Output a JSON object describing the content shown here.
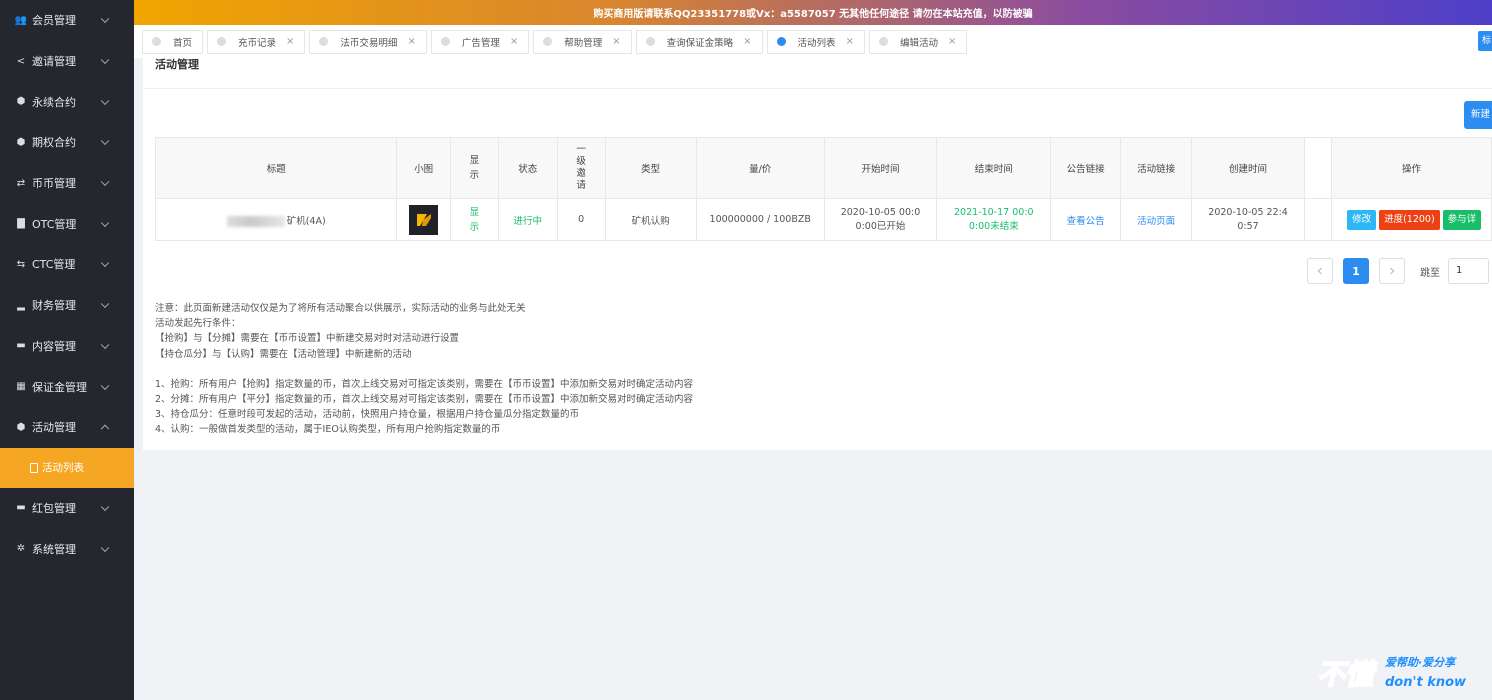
{
  "banner": {
    "text": "购买商用版请联系QQ23351778或Vx：a5587057 无其他任何途径 请勿在本站充值，以防被骗"
  },
  "sidebar": {
    "items": [
      {
        "label": "会员管理",
        "icon": "users-icon",
        "glyph": "👥"
      },
      {
        "label": "邀请管理",
        "icon": "share-icon",
        "glyph": "<"
      },
      {
        "label": "永续合约",
        "icon": "cube-icon",
        "glyph": "⬢"
      },
      {
        "label": "期权合约",
        "icon": "cube-icon",
        "glyph": "⬢"
      },
      {
        "label": "币币管理",
        "icon": "sliders-icon",
        "glyph": "⇄"
      },
      {
        "label": "OTC管理",
        "icon": "briefcase-icon",
        "glyph": "▇"
      },
      {
        "label": "CTC管理",
        "icon": "exchange-icon",
        "glyph": "⇆"
      },
      {
        "label": "财务管理",
        "icon": "chart-icon",
        "glyph": "▂"
      },
      {
        "label": "内容管理",
        "icon": "folder-icon",
        "glyph": "▬"
      },
      {
        "label": "保证金管理",
        "icon": "keyboard-icon",
        "glyph": "▦"
      },
      {
        "label": "活动管理",
        "icon": "cube-icon",
        "glyph": "⬢"
      }
    ],
    "active_sub": "活动列表",
    "items_after": [
      {
        "label": "红包管理",
        "icon": "wallet-icon",
        "glyph": "▬"
      },
      {
        "label": "系统管理",
        "icon": "gear-icon",
        "glyph": "✲"
      }
    ]
  },
  "tabs": [
    {
      "label": "首页",
      "closable": false,
      "active": false
    },
    {
      "label": "充币记录",
      "closable": true,
      "active": false
    },
    {
      "label": "法币交易明细",
      "closable": true,
      "active": false
    },
    {
      "label": "广告管理",
      "closable": true,
      "active": false
    },
    {
      "label": "帮助管理",
      "closable": true,
      "active": false
    },
    {
      "label": "查询保证金策略",
      "closable": true,
      "active": false
    },
    {
      "label": "活动列表",
      "closable": true,
      "active": true
    },
    {
      "label": "编辑活动",
      "closable": true,
      "active": false
    }
  ],
  "tab_right_label": "标",
  "panel": {
    "title": "活动管理",
    "new_button": "新建"
  },
  "table": {
    "headers": [
      "标题",
      "小图",
      "显示",
      "状态",
      "一级邀请",
      "类型",
      "量/价",
      "开始时间",
      "结束时间",
      "公告链接",
      "活动链接",
      "创建时间",
      "",
      "操作"
    ],
    "row": {
      "title": "矿机(4A)",
      "show": "显示",
      "status": "进行中",
      "invite": "0",
      "type": "矿机认购",
      "qty_price": "100000000 / 100BZB",
      "start": "2020-10-05 00:00:00已开始",
      "end": "2021-10-17 00:00:00未结束",
      "notice_link": "查看公告",
      "activity_link": "活动页面",
      "created": "2020-10-05 22:40:57",
      "ops": [
        {
          "label": "修改",
          "color": "#2db7f5"
        },
        {
          "label": "进度(1200)",
          "color": "#ed4014"
        },
        {
          "label": "参与详",
          "color": "#19be6b"
        }
      ]
    }
  },
  "pager": {
    "current": "1",
    "jump_label": "跳至",
    "jump_value": "1"
  },
  "notes": [
    "注意：此页面新建活动仅仅是为了将所有活动聚合以供展示，实际活动的业务与此处无关",
    "活动发起先行条件：",
    "【抢购】与【分摊】需要在【币币设置】中新建交易对时对活动进行设置",
    "【持仓瓜分】与【认购】需要在【活动管理】中新建新的活动",
    "",
    "1、抢购：所有用户【抢购】指定数量的币，首次上线交易对可指定该类别，需要在【币币设置】中添加新交易对时确定活动内容",
    "2、分摊：所有用户【平分】指定数量的币，首次上线交易对可指定该类别，需要在【币币设置】中添加新交易对时确定活动内容",
    "3、持仓瓜分：任意时段可发起的活动，活动前，快照用户持仓量，根据用户持仓量瓜分指定数量的币",
    "4、认购：一般做首发类型的活动，属于IEO认购类型，所有用户抢购指定数量的币"
  ],
  "watermark": {
    "line1": "不懂",
    "line2": "爱帮助·爱分享",
    "line3": "don't know"
  }
}
